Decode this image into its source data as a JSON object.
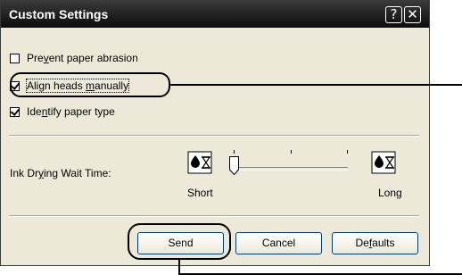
{
  "window": {
    "title": "Custom Settings",
    "help_glyph": "?",
    "close_glyph": "✕"
  },
  "options": [
    {
      "label_pre": "Pre",
      "label_u": "v",
      "label_post": "ent paper abrasion",
      "checked": false
    },
    {
      "label_pre": "Align heads ",
      "label_u": "m",
      "label_post": "anually",
      "checked": true
    },
    {
      "label_pre": "Ide",
      "label_u": "n",
      "label_post": "tify paper type",
      "checked": true
    }
  ],
  "ink_drying": {
    "label_pre": "Ink Dr",
    "label_u": "y",
    "label_post": "ing Wait Time:",
    "min_label": "Short",
    "max_label": "Long",
    "level": 0,
    "icon": "ink-drop-hourglass-icon"
  },
  "buttons": {
    "send": "Send",
    "cancel": "Cancel",
    "defaults_pre": "De",
    "defaults_u": "f",
    "defaults_post": "aults"
  }
}
